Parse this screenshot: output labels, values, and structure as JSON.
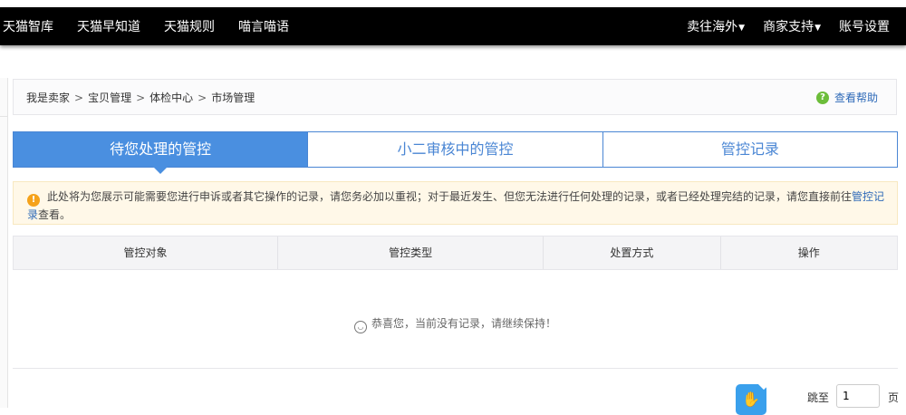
{
  "topbar": {
    "left_items": [
      "天猫智库",
      "天猫早知道",
      "天猫规则",
      "喵言喵语"
    ],
    "right_items": [
      {
        "label": "卖往海外",
        "dropdown": true
      },
      {
        "label": "商家支持",
        "dropdown": true
      },
      {
        "label": "账号设置",
        "dropdown": false
      }
    ]
  },
  "breadcrumb": {
    "items": [
      "我是卖家",
      "宝贝管理",
      "体检中心",
      "市场管理"
    ],
    "separator": ">"
  },
  "help": {
    "label": "查看帮助"
  },
  "tabs": [
    {
      "label": "待您处理的管控",
      "active": true
    },
    {
      "label": "小二审核中的管控",
      "active": false
    },
    {
      "label": "管控记录",
      "active": false
    }
  ],
  "notice": {
    "text": "此处将为您展示可能需要您进行申诉或者其它操作的记录，请您务必加以重视；对于最近发生、但您无法进行任何处理的记录，或者已经处理完结的记录，请您直接前往",
    "link": "管控记录",
    "tail": "查看。"
  },
  "table": {
    "headers": [
      "管控对象",
      "管控类型",
      "处置方式",
      "操作"
    ],
    "empty_message": "恭喜您，当前没有记录，请继续保持！"
  },
  "pagination": {
    "jump_label": "跳至",
    "page_value": "1",
    "unit": "页"
  },
  "colors": {
    "topbar_bg": "#000000",
    "tab_active_bg": "#4a8fe0",
    "tab_text": "#4a86d4",
    "link": "#2e6ab8",
    "notice_bg": "#fff8e8",
    "warn_icon": "#f5a21a",
    "help_icon": "#6cbd3a"
  }
}
